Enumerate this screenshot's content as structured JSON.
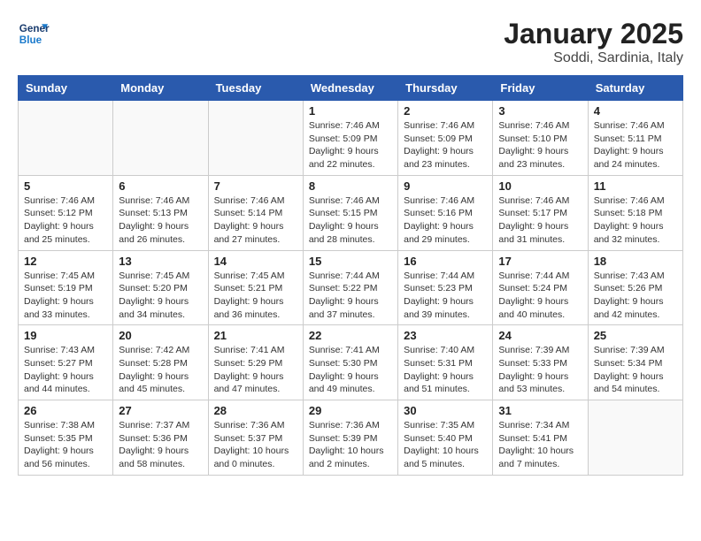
{
  "logo": {
    "line1": "General",
    "line2": "Blue"
  },
  "title": "January 2025",
  "location": "Soddi, Sardinia, Italy",
  "weekdays": [
    "Sunday",
    "Monday",
    "Tuesday",
    "Wednesday",
    "Thursday",
    "Friday",
    "Saturday"
  ],
  "weeks": [
    [
      {
        "day": "",
        "info": ""
      },
      {
        "day": "",
        "info": ""
      },
      {
        "day": "",
        "info": ""
      },
      {
        "day": "1",
        "info": "Sunrise: 7:46 AM\nSunset: 5:09 PM\nDaylight: 9 hours\nand 22 minutes."
      },
      {
        "day": "2",
        "info": "Sunrise: 7:46 AM\nSunset: 5:09 PM\nDaylight: 9 hours\nand 23 minutes."
      },
      {
        "day": "3",
        "info": "Sunrise: 7:46 AM\nSunset: 5:10 PM\nDaylight: 9 hours\nand 23 minutes."
      },
      {
        "day": "4",
        "info": "Sunrise: 7:46 AM\nSunset: 5:11 PM\nDaylight: 9 hours\nand 24 minutes."
      }
    ],
    [
      {
        "day": "5",
        "info": "Sunrise: 7:46 AM\nSunset: 5:12 PM\nDaylight: 9 hours\nand 25 minutes."
      },
      {
        "day": "6",
        "info": "Sunrise: 7:46 AM\nSunset: 5:13 PM\nDaylight: 9 hours\nand 26 minutes."
      },
      {
        "day": "7",
        "info": "Sunrise: 7:46 AM\nSunset: 5:14 PM\nDaylight: 9 hours\nand 27 minutes."
      },
      {
        "day": "8",
        "info": "Sunrise: 7:46 AM\nSunset: 5:15 PM\nDaylight: 9 hours\nand 28 minutes."
      },
      {
        "day": "9",
        "info": "Sunrise: 7:46 AM\nSunset: 5:16 PM\nDaylight: 9 hours\nand 29 minutes."
      },
      {
        "day": "10",
        "info": "Sunrise: 7:46 AM\nSunset: 5:17 PM\nDaylight: 9 hours\nand 31 minutes."
      },
      {
        "day": "11",
        "info": "Sunrise: 7:46 AM\nSunset: 5:18 PM\nDaylight: 9 hours\nand 32 minutes."
      }
    ],
    [
      {
        "day": "12",
        "info": "Sunrise: 7:45 AM\nSunset: 5:19 PM\nDaylight: 9 hours\nand 33 minutes."
      },
      {
        "day": "13",
        "info": "Sunrise: 7:45 AM\nSunset: 5:20 PM\nDaylight: 9 hours\nand 34 minutes."
      },
      {
        "day": "14",
        "info": "Sunrise: 7:45 AM\nSunset: 5:21 PM\nDaylight: 9 hours\nand 36 minutes."
      },
      {
        "day": "15",
        "info": "Sunrise: 7:44 AM\nSunset: 5:22 PM\nDaylight: 9 hours\nand 37 minutes."
      },
      {
        "day": "16",
        "info": "Sunrise: 7:44 AM\nSunset: 5:23 PM\nDaylight: 9 hours\nand 39 minutes."
      },
      {
        "day": "17",
        "info": "Sunrise: 7:44 AM\nSunset: 5:24 PM\nDaylight: 9 hours\nand 40 minutes."
      },
      {
        "day": "18",
        "info": "Sunrise: 7:43 AM\nSunset: 5:26 PM\nDaylight: 9 hours\nand 42 minutes."
      }
    ],
    [
      {
        "day": "19",
        "info": "Sunrise: 7:43 AM\nSunset: 5:27 PM\nDaylight: 9 hours\nand 44 minutes."
      },
      {
        "day": "20",
        "info": "Sunrise: 7:42 AM\nSunset: 5:28 PM\nDaylight: 9 hours\nand 45 minutes."
      },
      {
        "day": "21",
        "info": "Sunrise: 7:41 AM\nSunset: 5:29 PM\nDaylight: 9 hours\nand 47 minutes."
      },
      {
        "day": "22",
        "info": "Sunrise: 7:41 AM\nSunset: 5:30 PM\nDaylight: 9 hours\nand 49 minutes."
      },
      {
        "day": "23",
        "info": "Sunrise: 7:40 AM\nSunset: 5:31 PM\nDaylight: 9 hours\nand 51 minutes."
      },
      {
        "day": "24",
        "info": "Sunrise: 7:39 AM\nSunset: 5:33 PM\nDaylight: 9 hours\nand 53 minutes."
      },
      {
        "day": "25",
        "info": "Sunrise: 7:39 AM\nSunset: 5:34 PM\nDaylight: 9 hours\nand 54 minutes."
      }
    ],
    [
      {
        "day": "26",
        "info": "Sunrise: 7:38 AM\nSunset: 5:35 PM\nDaylight: 9 hours\nand 56 minutes."
      },
      {
        "day": "27",
        "info": "Sunrise: 7:37 AM\nSunset: 5:36 PM\nDaylight: 9 hours\nand 58 minutes."
      },
      {
        "day": "28",
        "info": "Sunrise: 7:36 AM\nSunset: 5:37 PM\nDaylight: 10 hours\nand 0 minutes."
      },
      {
        "day": "29",
        "info": "Sunrise: 7:36 AM\nSunset: 5:39 PM\nDaylight: 10 hours\nand 2 minutes."
      },
      {
        "day": "30",
        "info": "Sunrise: 7:35 AM\nSunset: 5:40 PM\nDaylight: 10 hours\nand 5 minutes."
      },
      {
        "day": "31",
        "info": "Sunrise: 7:34 AM\nSunset: 5:41 PM\nDaylight: 10 hours\nand 7 minutes."
      },
      {
        "day": "",
        "info": ""
      }
    ]
  ]
}
